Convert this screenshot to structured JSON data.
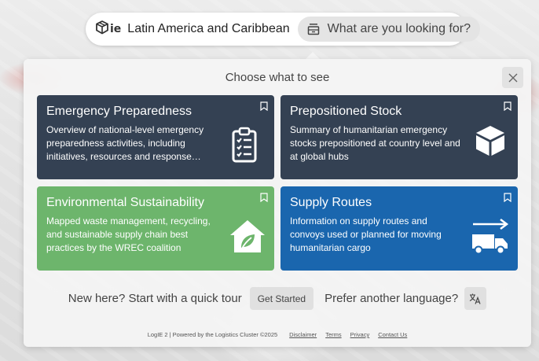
{
  "header": {
    "logo_text": "ie",
    "region": "Latin America and Caribbean",
    "search_placeholder": "What are you looking for?"
  },
  "panel": {
    "title": "Choose what to see",
    "cards": [
      {
        "title": "Emergency Preparedness",
        "description": "Overview of national-level emergency preparedness activities, including initiatives, resources and response…",
        "icon": "clipboard-checklist-icon",
        "color": "#344153"
      },
      {
        "title": "Prepositioned Stock",
        "description": "Summary of humanitarian emergency stocks prepositioned at country level and at global hubs",
        "icon": "box-icon",
        "color": "#344153"
      },
      {
        "title": "Environmental Sustainability",
        "description": "Mapped waste management, recycling, and sustainable supply chain best practices by the WREC coalition",
        "icon": "eco-house-icon",
        "color": "#6db56c"
      },
      {
        "title": "Supply Routes",
        "description": "Information on supply routes and convoys used or planned for moving humanitarian cargo",
        "icon": "truck-arrow-icon",
        "color": "#1a66ae"
      }
    ],
    "tour_text": "New here? Start with a quick tour",
    "get_started_label": "Get Started",
    "language_text": "Prefer another language?"
  },
  "footer": {
    "copyright": "LogIE 2 | Powered by the Logistics Cluster ©2025",
    "links": [
      "Disclaimer",
      "Terms",
      "Privacy",
      "Contact Us"
    ]
  }
}
